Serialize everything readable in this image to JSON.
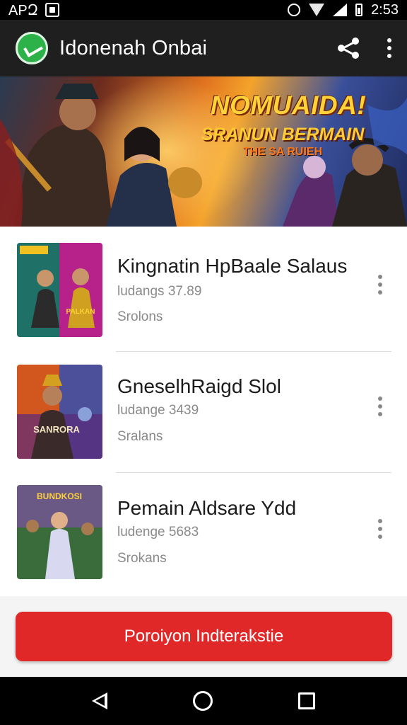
{
  "status_bar": {
    "left_text": "APԶ",
    "time": "2:53",
    "icons": [
      "notification-square-icon",
      "alarm-icon",
      "wifi-icon",
      "signal-icon",
      "battery-icon"
    ]
  },
  "app_bar": {
    "title": "Idonenah Onbai",
    "logo_icon": "app-logo-icon",
    "actions": [
      "share-icon",
      "more-vertical-icon"
    ]
  },
  "banner": {
    "title": "NOMUAIDA!",
    "subtitle": "SRANUN BERMAIN",
    "tagline": "THE SA RUIEH"
  },
  "games": [
    {
      "name": "Kingnatin HpBaale Salaus",
      "downloads": "ludangs 37.89",
      "status": "Srolons",
      "thumb_label": "PALKAN",
      "colors": [
        "#2e7dd1",
        "#1a6b3a",
        "#b6228a"
      ]
    },
    {
      "name": "GneselhRaigd Slol",
      "downloads": "ludange 3439",
      "status": "Sralans",
      "thumb_label": "SANRORA",
      "colors": [
        "#d2571e",
        "#5b2a7b",
        "#2a4db8"
      ]
    },
    {
      "name": "Pemain Aldsare Ydd",
      "downloads": "ludenge 5683",
      "status": "Srokans",
      "thumb_label": "BUNDKOSI",
      "colors": [
        "#c9a227",
        "#3a6b3a",
        "#8a4bb8"
      ]
    }
  ],
  "cta": {
    "label": "Poroiyon Indterakstie",
    "color": "#e02828"
  },
  "nav_bar": {
    "icons": [
      "back-icon",
      "home-icon",
      "recents-icon"
    ]
  }
}
